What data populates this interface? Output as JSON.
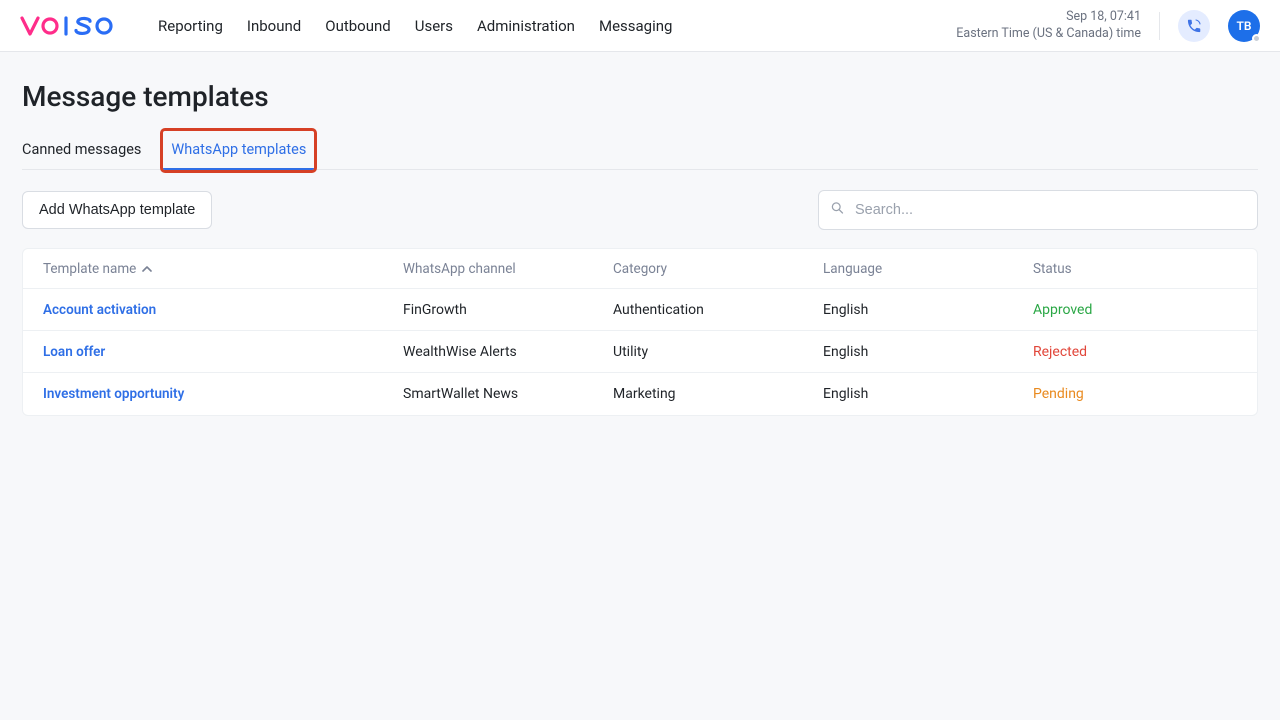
{
  "header": {
    "logo_letters": [
      "V",
      "O",
      "I",
      "S",
      "O"
    ],
    "logo_colors": [
      "#ff2d8a",
      "#ff2d8a",
      "#2a6df5",
      "#2a6df5",
      "#2a6df5"
    ],
    "nav": [
      "Reporting",
      "Inbound",
      "Outbound",
      "Users",
      "Administration",
      "Messaging"
    ],
    "datetime_line1": "Sep 18, 07:41",
    "datetime_line2": "Eastern Time (US & Canada) time",
    "avatar_initials": "TB"
  },
  "page": {
    "title": "Message templates",
    "tabs": [
      {
        "label": "Canned messages",
        "active": false
      },
      {
        "label": "WhatsApp templates",
        "active": true
      }
    ],
    "add_button_label": "Add WhatsApp template",
    "search_placeholder": "Search..."
  },
  "table": {
    "columns": [
      "Template name",
      "WhatsApp channel",
      "Category",
      "Language",
      "Status"
    ],
    "sorted_column_index": 0,
    "sort_direction": "asc",
    "rows": [
      {
        "name": "Account activation",
        "channel": "FinGrowth",
        "category": "Authentication",
        "language": "English",
        "status": "Approved",
        "status_class": "approved"
      },
      {
        "name": "Loan offer",
        "channel": "WealthWise Alerts",
        "category": "Utility",
        "language": "English",
        "status": "Rejected",
        "status_class": "rejected"
      },
      {
        "name": "Investment opportunity",
        "channel": "SmartWallet News",
        "category": "Marketing",
        "language": "English",
        "status": "Pending",
        "status_class": "pending"
      }
    ]
  }
}
